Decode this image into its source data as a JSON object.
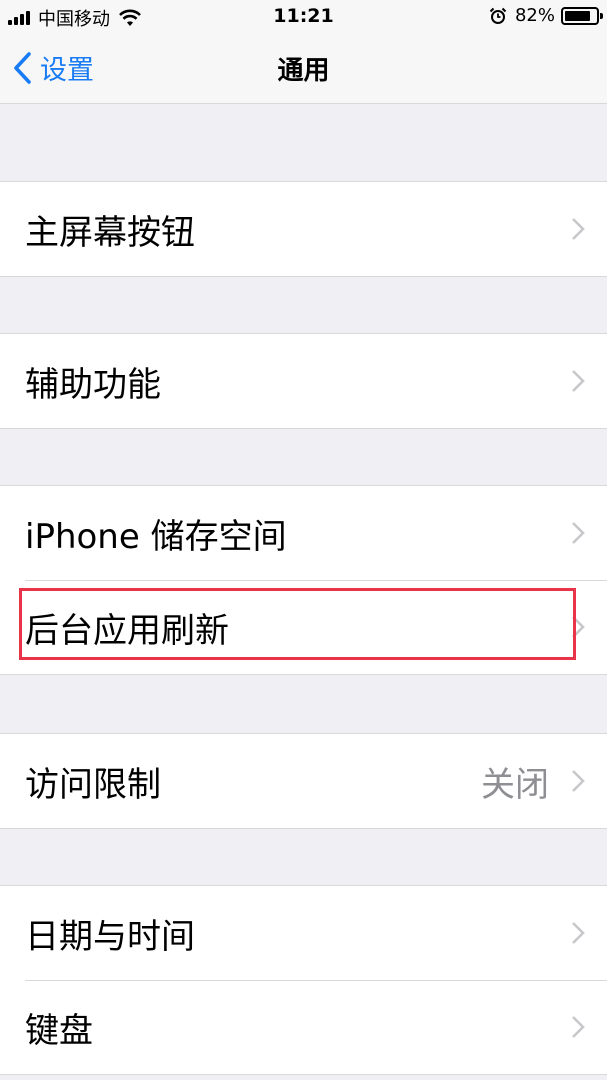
{
  "status_bar": {
    "carrier": "中国移动",
    "time": "11:21",
    "battery_percent": "82%",
    "battery_level": 0.82,
    "signal_bars": 4
  },
  "nav": {
    "back_label": "设置",
    "title": "通用"
  },
  "groups": [
    {
      "items": [
        {
          "label": "主屏幕按钮",
          "value": ""
        }
      ]
    },
    {
      "items": [
        {
          "label": "辅助功能",
          "value": ""
        }
      ]
    },
    {
      "items": [
        {
          "label": "iPhone 储存空间",
          "value": ""
        },
        {
          "label": "后台应用刷新",
          "value": ""
        }
      ]
    },
    {
      "items": [
        {
          "label": "访问限制",
          "value": "关闭"
        }
      ]
    },
    {
      "items": [
        {
          "label": "日期与时间",
          "value": ""
        },
        {
          "label": "键盘",
          "value": ""
        }
      ]
    }
  ],
  "colors": {
    "accent": "#1a7cf5",
    "highlight_border": "#e8334a",
    "background": "#efeff4"
  },
  "icons": [
    "signal-icon",
    "wifi-icon",
    "alarm-icon",
    "battery-icon",
    "back-chevron-icon",
    "chevron-right-icon"
  ]
}
